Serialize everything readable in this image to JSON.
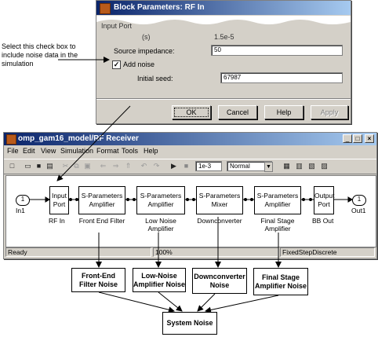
{
  "dialog": {
    "title": "Block Parameters: RF In",
    "torn_label_1": "Input Port",
    "torn_label_2": "(s)",
    "torn_value": "1.5e-5",
    "source_impedance_label": "Source impedance:",
    "source_impedance_value": "50",
    "add_noise_label": "Add noise",
    "add_noise_checked": "✓",
    "initial_seed_label": "Initial seed:",
    "initial_seed_value": "67987",
    "buttons": {
      "ok": "OK",
      "cancel": "Cancel",
      "help": "Help",
      "apply": "Apply"
    }
  },
  "annotation": "Select this check box to include noise data in the simulation",
  "model_window": {
    "title": "omp_gam16_model/RF Receiver",
    "menus": [
      "File",
      "Edit",
      "View",
      "Simulation",
      "Format",
      "Tools",
      "Help"
    ],
    "stop_time": "1e-3",
    "sim_mode": "Normal",
    "blocks": {
      "in1_port": "1",
      "in1_label": "In1",
      "input_port": "Input Port",
      "input_port_cap": "RF In",
      "sparam1": "S-Parameters Amplifier",
      "sparam1_cap": "Front End Filter",
      "sparam2": "S-Parameters Amplifier",
      "sparam2_cap": "Low Noise Amplifier",
      "mixer": "S-Parameters Mixer",
      "mixer_cap": "Downconverter",
      "sparam3": "S-Parameters Amplifier",
      "sparam3_cap": "Final Stage Amplifier",
      "output_port": "Output Port",
      "output_port_cap": "BB Out",
      "out1_port": "1",
      "out1_label": "Out1"
    },
    "status": {
      "ready": "Ready",
      "zoom": "100%",
      "solver": "FixedStepDiscrete"
    }
  },
  "noise_boxes": {
    "front_end": "Front-End Filter Noise",
    "low_noise": "Low-Noise Amplifier Noise",
    "downconverter": "Downconverter Noise",
    "final_stage": "Final Stage Amplifier Noise",
    "system": "System Noise"
  },
  "colors": {
    "title_start": "#0a246a",
    "title_end": "#a6caf0",
    "chrome": "#d4d0c8"
  },
  "icons": [
    "matlab-app-icon",
    "new-icon",
    "open-icon",
    "save-icon",
    "print-icon",
    "cut-icon",
    "copy-icon",
    "paste-icon",
    "back-icon",
    "forward-icon",
    "up-icon",
    "undo-icon",
    "redo-icon",
    "play-icon",
    "stop-icon",
    "library-icon",
    "explorer-icon",
    "debug-icon",
    "build-icon"
  ]
}
